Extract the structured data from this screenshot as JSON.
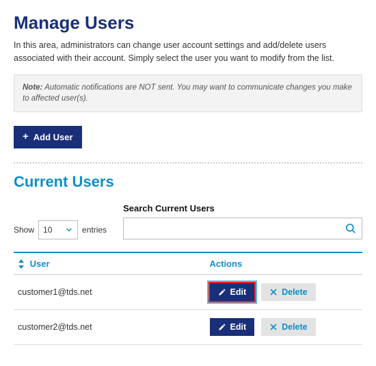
{
  "header": {
    "title": "Manage Users",
    "intro": "In this area, administrators can change user account settings and add/delete users associated with their account. Simply select the user you want to modify from the list."
  },
  "note": {
    "label": "Note:",
    "text": " Automatic notifications are NOT sent. You may want to communicate changes you make to affected user(s)."
  },
  "buttons": {
    "add_user": "Add User",
    "edit": "Edit",
    "delete": "Delete"
  },
  "section": {
    "current_users": "Current Users"
  },
  "pager": {
    "show_label": "Show",
    "entries_label": "entries",
    "page_size": "10"
  },
  "search": {
    "label": "Search Current Users",
    "value": "",
    "placeholder": ""
  },
  "table": {
    "columns": {
      "user": "User",
      "actions": "Actions"
    },
    "rows": [
      {
        "user": "customer1@tds.net",
        "highlight_edit": true
      },
      {
        "user": "customer2@tds.net",
        "highlight_edit": false
      }
    ]
  }
}
